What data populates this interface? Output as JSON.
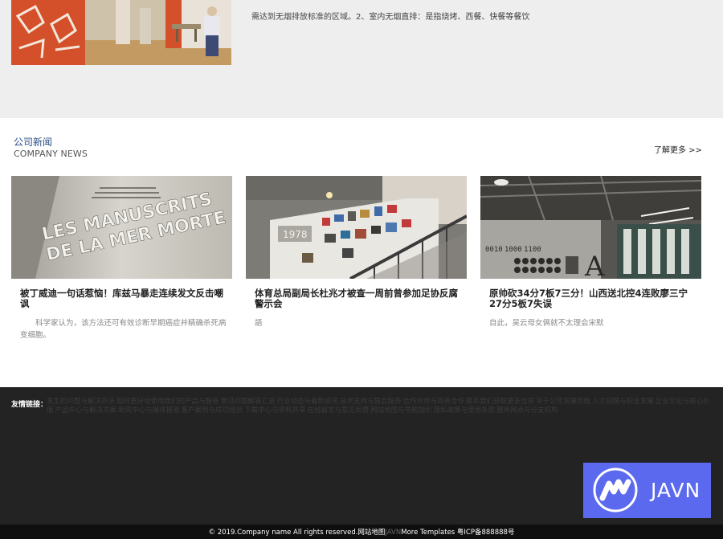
{
  "top": {
    "text": "需达到无烟排放标准的区域。2、室内无烟直排：是指烧烤、西餐、快餐等餐饮"
  },
  "news": {
    "title": "公司新闻",
    "subtitle": "COMPANY NEWS",
    "more": "了解更多 >>"
  },
  "cards": [
    {
      "title": "被丁威迪一句话惹恼！库兹马暴走连续发文反击嘲讽",
      "desc": "科学家认为，该方法还可有效诊断早期癌症并精确杀死病变细胞。",
      "img_text": [
        "LES MANUSCRITS",
        "DE LA MER MORTE"
      ]
    },
    {
      "title": "体育总局副局长杜兆才被查一周前曾参加足协反腐警示会",
      "desc": "語",
      "img_text": [
        "1978"
      ]
    },
    {
      "title": "原帅砍34分7板7三分！山西送北控4连败廖三宁27分5板7失误",
      "desc": "自此，吴云母女俩就不太理会宋默",
      "img_text": [
        "0010",
        "1000",
        "1100",
        "A"
      ]
    }
  ],
  "footer": {
    "links_label": "友情链接：",
    "links": [
      "发生的问题与解决办法",
      "如何更好地使用我们的产品与服务",
      "常见问题解答汇总",
      "行业动态与最新资讯",
      "技术支持与售后服务",
      "合作伙伴与商务合作",
      "联系我们获取更多信息",
      "关于公司发展历程",
      "人才招聘与职业发展",
      "企业文化与核心价值",
      "产品中心与解决方案",
      "新闻中心与媒体报道",
      "客户案例与成功经验",
      "下载中心与资料共享",
      "在线留言与意见反馈",
      "网站地图与导航指引",
      "隐私政策与使用条款",
      "服务网点与分支机构"
    ],
    "copyright_pre": "© 2019.Company name All rights reserved.网站地图",
    "copyright_dim": "JAVN",
    "copyright_mid": "More Templates 粤ICP备888888号"
  },
  "badge": {
    "text": "JAVN",
    "color": "#5b69ee"
  },
  "colors": {
    "top_band": "#eeeeee",
    "footer": "#232323",
    "accent_title": "#2b4e86"
  }
}
